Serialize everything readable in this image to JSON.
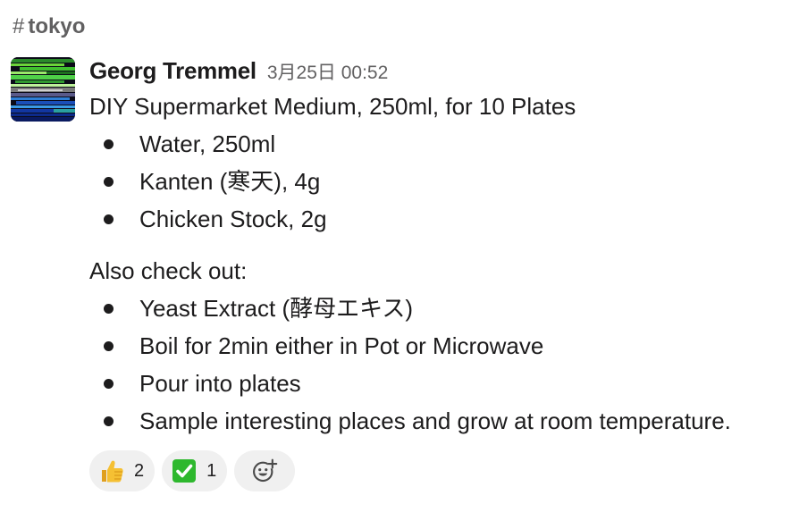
{
  "channel": {
    "hash": "#",
    "name": "tokyo"
  },
  "message": {
    "sender": "Georg Tremmel",
    "timestamp": "3月25日 00:52",
    "title": "DIY Supermarket Medium, 250ml, for 10 Plates",
    "ingredients": [
      "Water, 250ml",
      "Kanten (寒天), 4g",
      "Chicken Stock, 2g"
    ],
    "also_label": "Also check out:",
    "also_items": [
      "Yeast Extract (酵母エキス)"
    ],
    "steps": [
      "Boil for 2min either in Pot or Microwave",
      "Pour into plates",
      "Sample interesting places and grow at room temperature."
    ]
  },
  "reactions": [
    {
      "icon": "thumbs-up-icon",
      "count": "2"
    },
    {
      "icon": "check-mark-icon",
      "count": "1"
    }
  ],
  "add_reaction_icon": "add-reaction-icon",
  "colors": {
    "text": "#1d1c1d",
    "muted": "#616061",
    "reaction_bg": "#f0f0f0",
    "check_green": "#2eb82e",
    "thumb_yellow": "#f5c033"
  }
}
